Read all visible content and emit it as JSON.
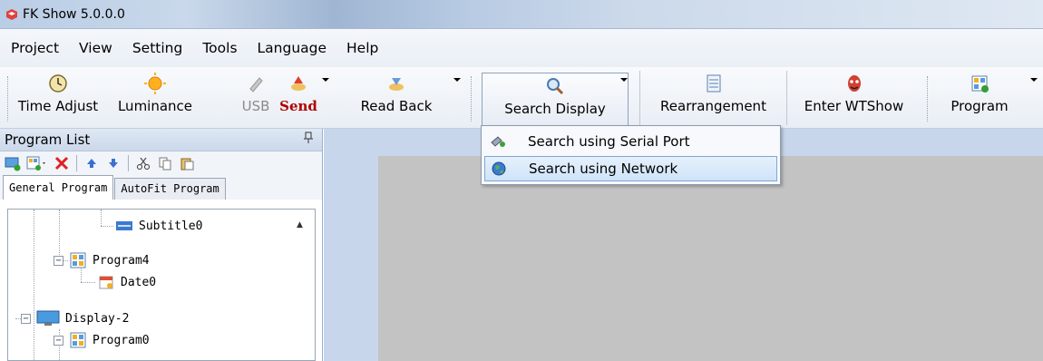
{
  "window": {
    "title": "FK Show 5.0.0.0"
  },
  "menu": [
    "Project",
    "View",
    "Setting",
    "Tools",
    "Language",
    "Help"
  ],
  "toolbar": {
    "time_adjust": "Time Adjust",
    "luminance": "Luminance",
    "usb": "USB",
    "send": "Send",
    "read_back": "Read Back",
    "search_display": "Search Display",
    "rearrangement": "Rearrangement",
    "enter_wtshow": "Enter WTShow",
    "program": "Program"
  },
  "dropdown": {
    "items": [
      "Search using Serial Port",
      "Search using Network"
    ],
    "highlighted": "Search using Network"
  },
  "panel": {
    "title": "Program List",
    "pin": "ᵖ",
    "tabs": [
      "General Program",
      "AutoFit Program"
    ],
    "active_tab": "General Program"
  },
  "tree": {
    "rows": [
      {
        "label": "Subtitle0",
        "icon": "subtitle-icon"
      },
      {
        "label": "Program4",
        "icon": "program-icon"
      },
      {
        "label": "Date0",
        "icon": "date-icon"
      },
      {
        "label": "Display-2",
        "icon": "display-icon"
      },
      {
        "label": "Program0",
        "icon": "program-icon"
      }
    ]
  },
  "colors": {
    "accent": "#7fa7d6",
    "work_area": "#c7d6ea",
    "canvas": "#c3c3c3",
    "send_red": "#b00000"
  }
}
